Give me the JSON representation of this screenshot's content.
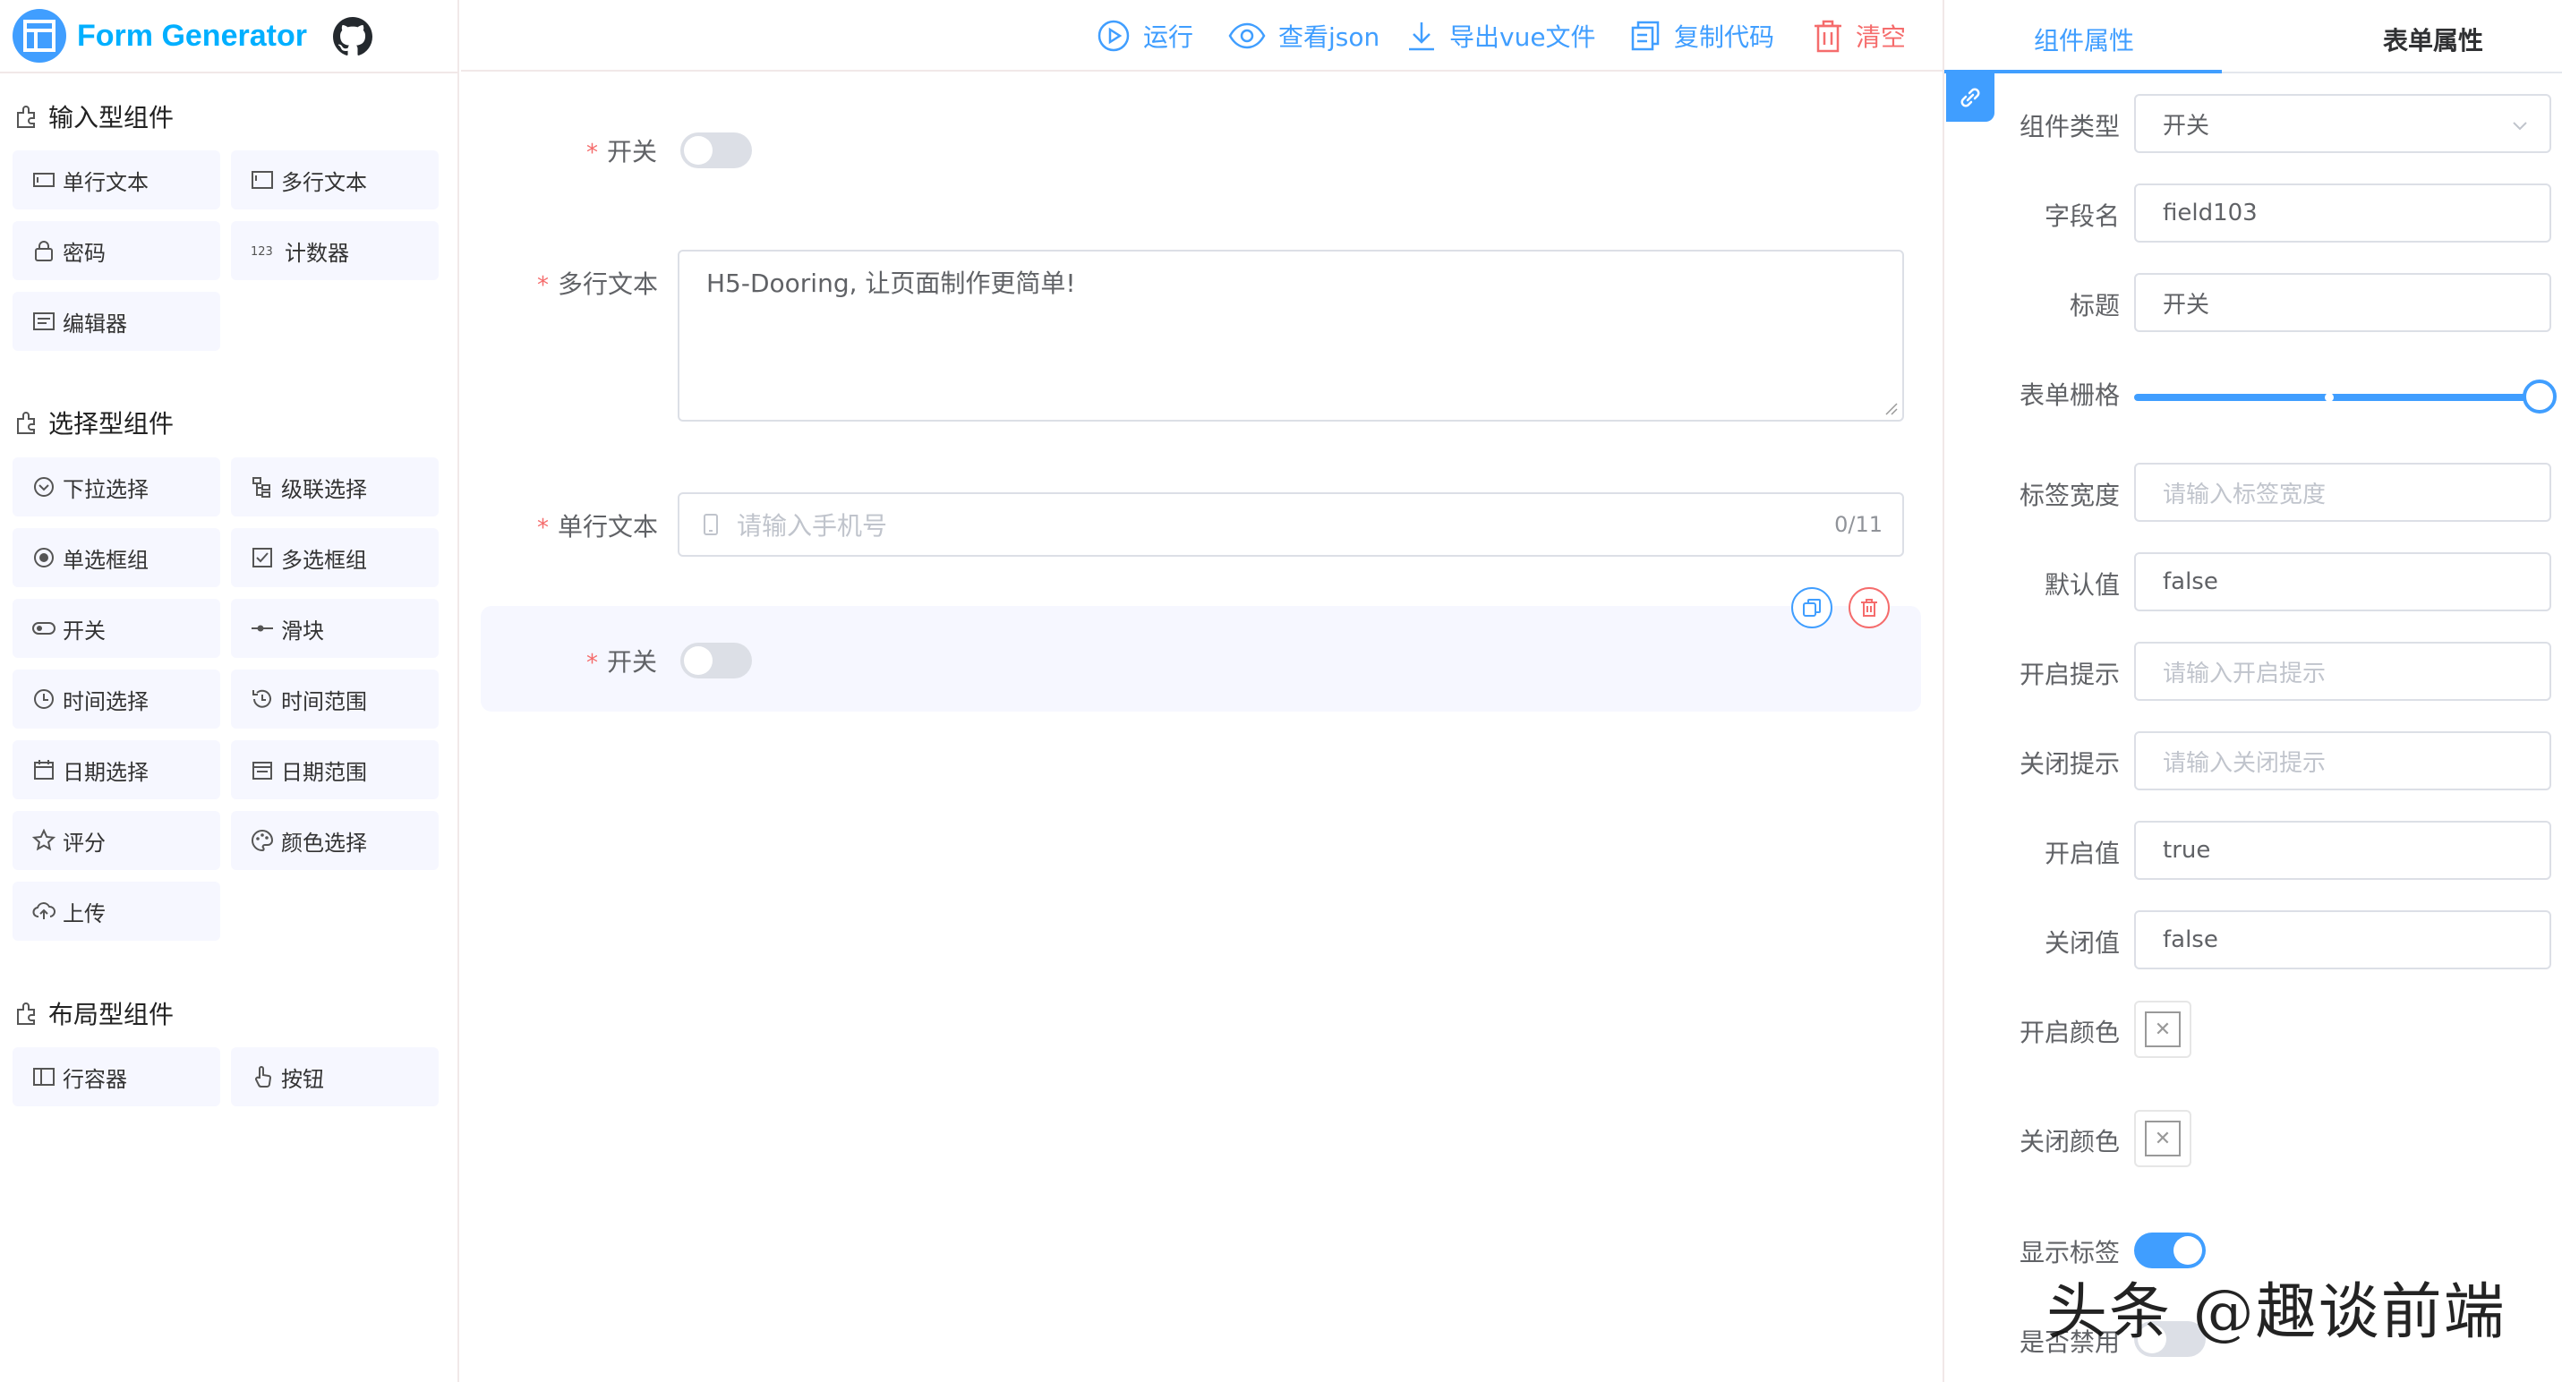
{
  "app": {
    "title": "Form Generator"
  },
  "toolbar": {
    "run": "运行",
    "view_json": "查看json",
    "export_vue": "导出vue文件",
    "copy_code": "复制代码",
    "clear": "清空"
  },
  "groups": {
    "input": {
      "title": "输入型组件",
      "items": [
        "单行文本",
        "多行文本",
        "密码",
        "计数器",
        "编辑器"
      ]
    },
    "select": {
      "title": "选择型组件",
      "items": [
        "下拉选择",
        "级联选择",
        "单选框组",
        "多选框组",
        "开关",
        "滑块",
        "时间选择",
        "时间范围",
        "日期选择",
        "日期范围",
        "评分",
        "颜色选择",
        "上传"
      ]
    },
    "layout": {
      "title": "布局型组件",
      "items": [
        "行容器",
        "按钮"
      ]
    }
  },
  "canvas": {
    "switch1_label": "开关",
    "textarea_label": "多行文本",
    "textarea_value": "H5-Dooring, 让页面制作更简单!",
    "input_label": "单行文本",
    "input_placeholder": "请输入手机号",
    "input_count": "0/11",
    "switch2_label": "开关"
  },
  "panel": {
    "tabs": [
      "组件属性",
      "表单属性"
    ],
    "fields": {
      "component_type": {
        "label": "组件类型",
        "value": "开关"
      },
      "field_name": {
        "label": "字段名",
        "value": "field103"
      },
      "title": {
        "label": "标题",
        "value": "开关"
      },
      "grid": {
        "label": "表单栅格",
        "value": 24
      },
      "label_width": {
        "label": "标签宽度",
        "placeholder": "请输入标签宽度"
      },
      "default_value": {
        "label": "默认值",
        "value": "false"
      },
      "active_text": {
        "label": "开启提示",
        "placeholder": "请输入开启提示"
      },
      "inactive_text": {
        "label": "关闭提示",
        "placeholder": "请输入关闭提示"
      },
      "active_value": {
        "label": "开启值",
        "value": "true"
      },
      "inactive_value": {
        "label": "关闭值",
        "value": "false"
      },
      "active_color": {
        "label": "开启颜色"
      },
      "inactive_color": {
        "label": "关闭颜色"
      },
      "show_label": {
        "label": "显示标签",
        "value": true
      },
      "disabled": {
        "label": "是否禁用",
        "value": false
      }
    }
  },
  "watermark": "头条 @趣谈前端",
  "colors": {
    "primary": "#409eff",
    "danger": "#f56c6c",
    "item_bg": "#f6f7ff"
  }
}
